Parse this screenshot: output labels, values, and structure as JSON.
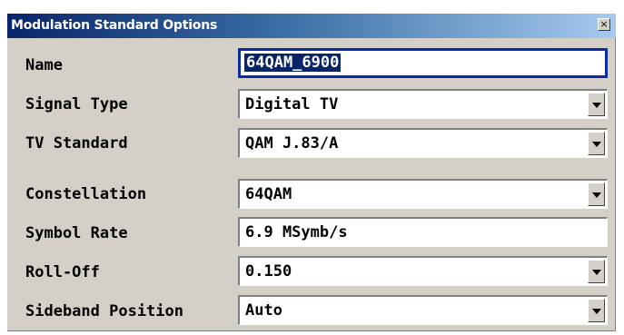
{
  "dialog": {
    "title": "Modulation Standard Options",
    "close_label": "×"
  },
  "rows": [
    {
      "label": "Name",
      "value": "64QAM_6900",
      "kind": "text",
      "focused": true
    },
    {
      "label": "Signal Type",
      "value": "Digital TV",
      "kind": "dropdown"
    },
    {
      "label": "TV Standard",
      "value": "QAM J.83/A",
      "kind": "dropdown"
    },
    {
      "label": "Constellation",
      "value": "64QAM",
      "kind": "dropdown"
    },
    {
      "label": "Symbol Rate",
      "value": "6.9 MSymb/s",
      "kind": "text"
    },
    {
      "label": "Roll-Off",
      "value": "0.150",
      "kind": "dropdown"
    },
    {
      "label": "Sideband Position",
      "value": "Auto",
      "kind": "dropdown"
    }
  ],
  "colors": {
    "title_gradient_start": "#0a246a",
    "title_gradient_end": "#a6caf0",
    "dialog_bg": "#d4d0c8",
    "focus_border": "#0a2ca6",
    "selection_bg": "#0a246a"
  }
}
